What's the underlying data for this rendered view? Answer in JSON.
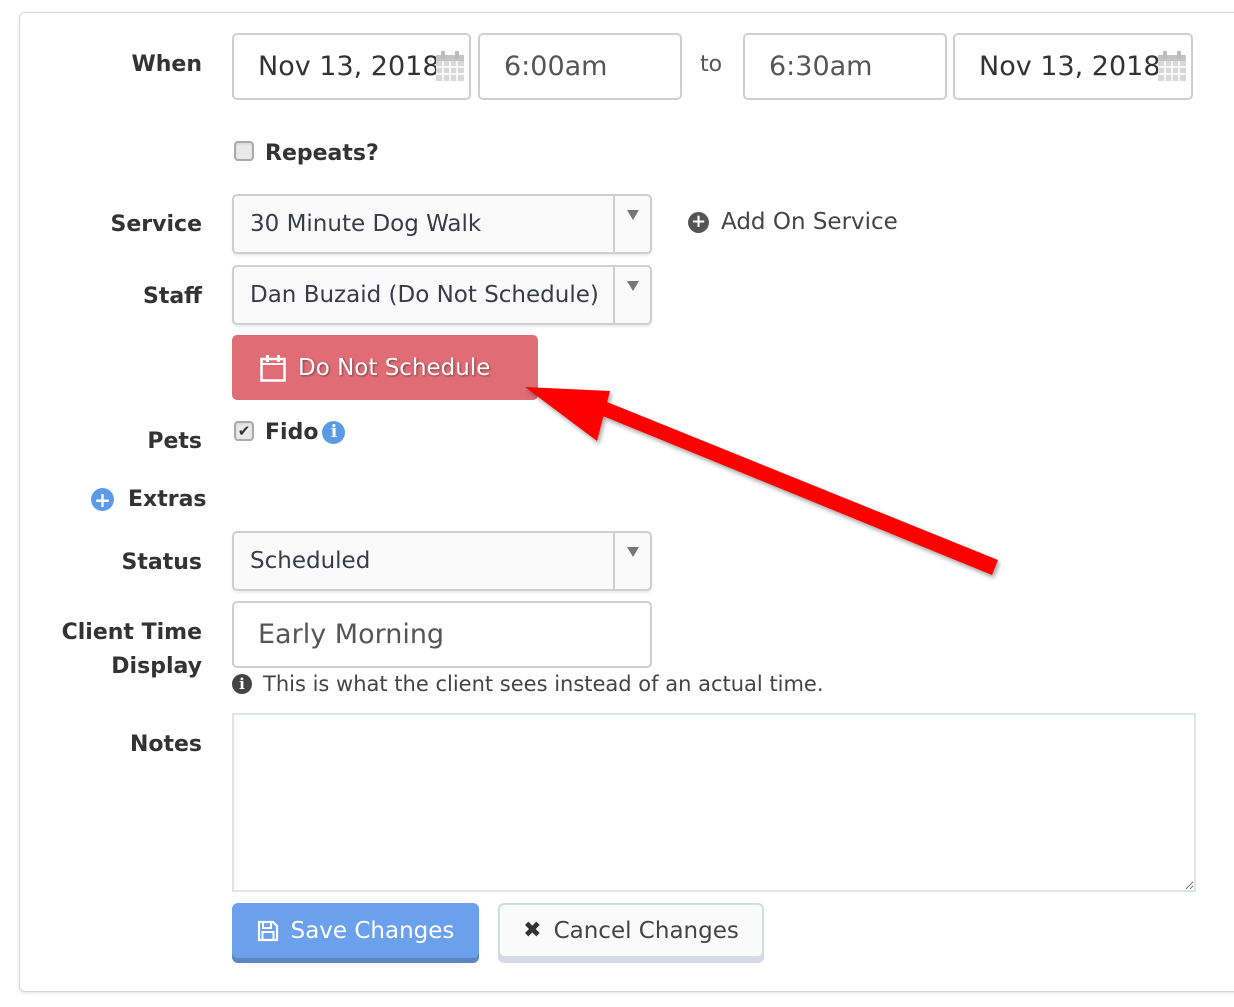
{
  "form": {
    "when": {
      "label": "When",
      "start_date": "Nov 13, 2018",
      "start_time": "6:00am",
      "separator": "to",
      "end_time": "6:30am",
      "end_date": "Nov 13, 2018"
    },
    "repeats": {
      "label": "Repeats?",
      "checked": false
    },
    "service": {
      "label": "Service",
      "selected": "30 Minute Dog Walk",
      "add_on_label": "Add On Service"
    },
    "staff": {
      "label": "Staff",
      "selected": "Dan Buzaid (Do Not Schedule)",
      "warning_button": "Do Not Schedule"
    },
    "pets": {
      "label": "Pets",
      "items": [
        {
          "name": "Fido",
          "checked": true
        }
      ]
    },
    "extras": {
      "label": "Extras"
    },
    "status": {
      "label": "Status",
      "selected": "Scheduled"
    },
    "client_time_display": {
      "label_line1": "Client Time",
      "label_line2": "Display",
      "value": "Early Morning",
      "help_text": "This is what the client sees instead of an actual time."
    },
    "notes": {
      "label": "Notes",
      "value": ""
    },
    "actions": {
      "save_label": "Save Changes",
      "cancel_label": "Cancel Changes"
    }
  },
  "colors": {
    "warning_button": "#e06d76",
    "primary_button": "#6aa0ec",
    "info_icon": "#5b9be6",
    "annotation_arrow": "#ff0000"
  },
  "annotation": {
    "type": "arrow",
    "points_to": "Do Not Schedule button"
  }
}
